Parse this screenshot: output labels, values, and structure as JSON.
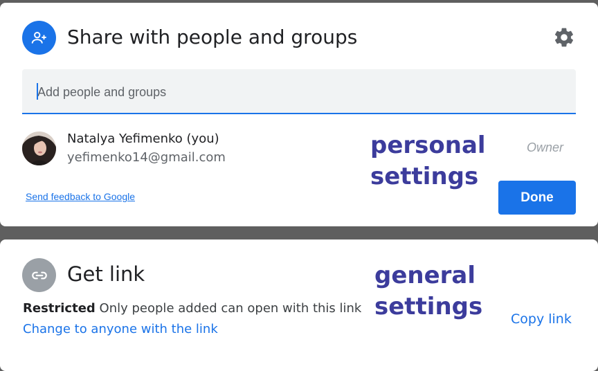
{
  "share_dialog": {
    "title": "Share with people and groups",
    "add_placeholder": "Add people and groups",
    "user": {
      "name": "Natalya Yefimenko (you)",
      "email": "yefimenko14@gmail.com",
      "role": "Owner"
    },
    "feedback_link": "Send feedback to Google",
    "done_label": "Done",
    "icons": {
      "header": "add-person-icon",
      "settings": "gear-icon"
    },
    "accent_color": "#1a73e8"
  },
  "annotations": {
    "personal": [
      "personal",
      "settings"
    ],
    "general": [
      "general",
      "settings"
    ]
  },
  "get_link": {
    "title": "Get link",
    "access_label": "Restricted",
    "access_description": "Only people added can open with this link",
    "change_link": "Change to anyone with the link",
    "copy_link": "Copy link",
    "icons": {
      "header": "link-icon"
    }
  }
}
